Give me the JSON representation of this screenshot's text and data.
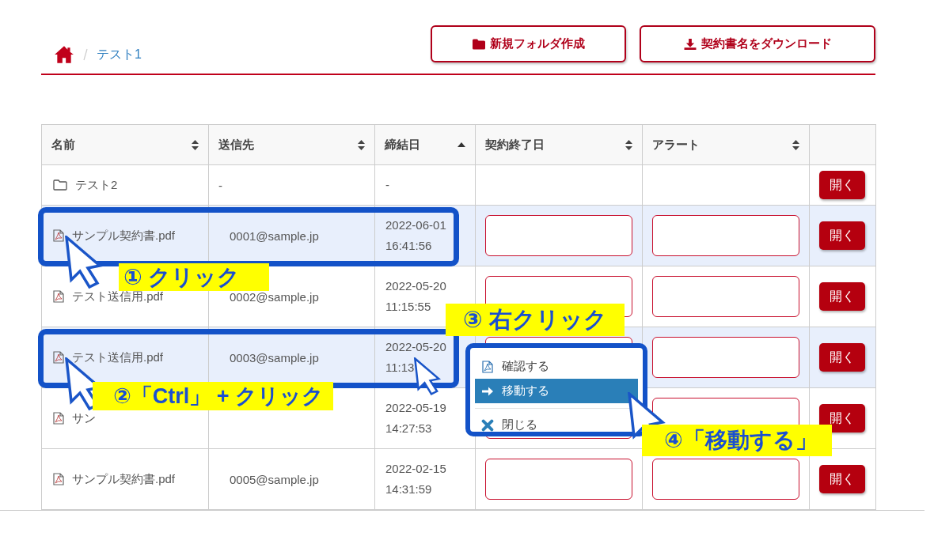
{
  "breadcrumb": [
    {
      "label": "テスト1"
    }
  ],
  "toolbar_buttons": [
    {
      "label": "新規フォルダ作成"
    },
    {
      "label": "契約書名をダウンロード"
    }
  ],
  "table": {
    "columns": [
      {
        "label": "名前",
        "kind": "sortable"
      },
      {
        "label": "送信先",
        "kind": "sortable"
      },
      {
        "label": "締結日",
        "kind": "sorted"
      },
      {
        "label": "契約終了日",
        "kind": "sortable"
      },
      {
        "label": "アラート",
        "kind": "sortable"
      },
      {
        "kind": "plain"
      }
    ],
    "rows": [
      {
        "kind": "folder",
        "selected": false,
        "name": "テスト2",
        "recipient": "-",
        "date": "-",
        "open": "開く"
      },
      {
        "kind": "file",
        "selected": true,
        "name": "サンプル契約書.pdf",
        "recipient": "0001@sample.jp",
        "date": "2022-06-01",
        "time": "16:41:56",
        "open": "開く"
      },
      {
        "kind": "file",
        "selected": false,
        "name": "テスト送信用.pdf",
        "recipient": "0002@sample.jp",
        "date": "2022-05-20",
        "time": "11:15:55",
        "open": "開く"
      },
      {
        "kind": "file",
        "selected": true,
        "name": "テスト送信用.pdf",
        "recipient": "0003@sample.jp",
        "date": "2022-05-20",
        "time": "11:13",
        "open": "開く"
      },
      {
        "kind": "file",
        "selected": false,
        "name": "サン",
        "date": "2022-05-19",
        "time": "14:27:53",
        "open": "開く"
      },
      {
        "kind": "file",
        "selected": false,
        "name": "サンプル契約書.pdf",
        "recipient": "0005@sample.jp",
        "date": "2022-02-15",
        "time": "14:31:59",
        "open": "開く"
      }
    ]
  },
  "context_menu": {
    "items": [
      {
        "label": "確認する",
        "selected": false,
        "separator_before": false
      },
      {
        "label": "移動する",
        "selected": true,
        "separator_before": false
      },
      {
        "label": "閉じる",
        "selected": false,
        "separator_before": true
      }
    ]
  },
  "annotations": [
    {
      "text": "① クリック"
    },
    {
      "text": "②「Ctrl」 + クリック"
    },
    {
      "text": "③ 右クリック"
    },
    {
      "text": "④「移動する」"
    }
  ]
}
